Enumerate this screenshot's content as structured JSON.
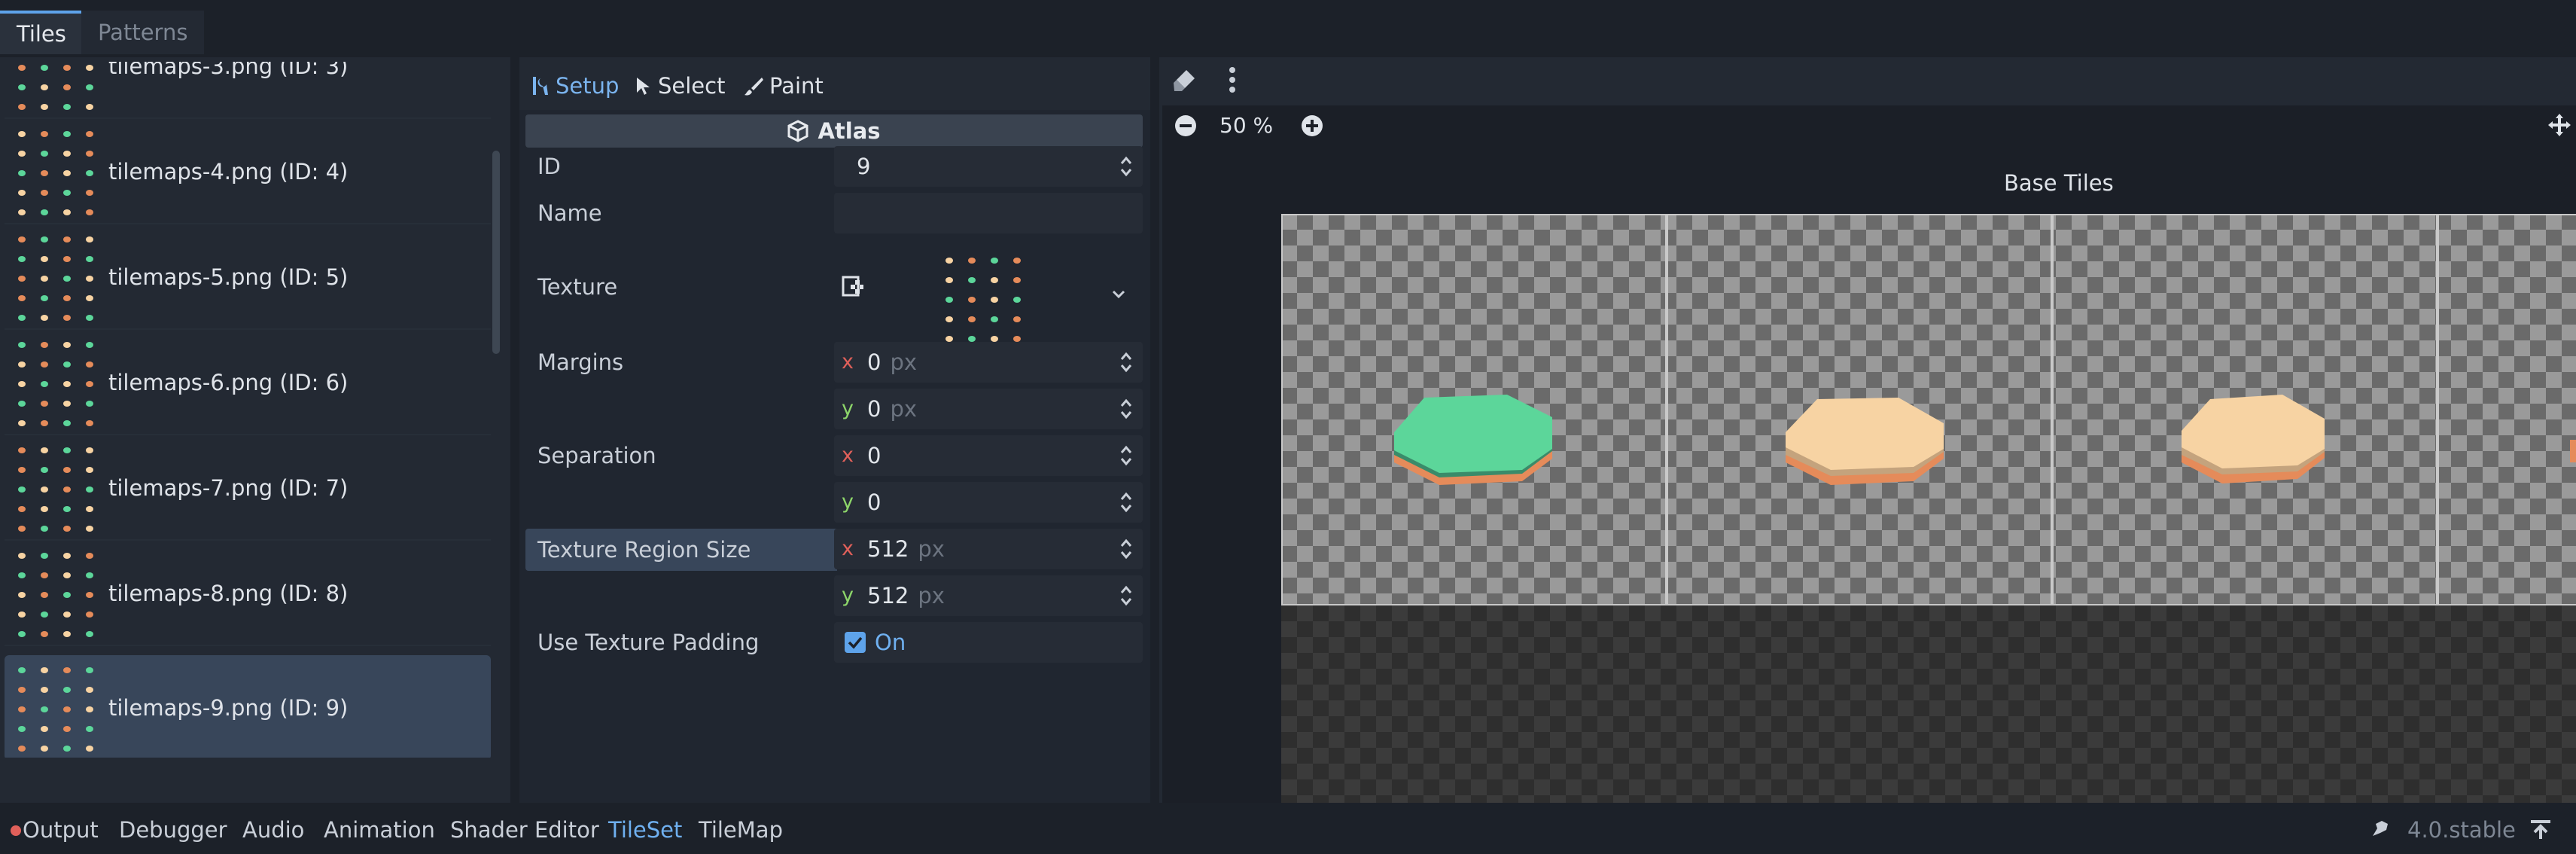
{
  "top_tabs": [
    {
      "label": "Tiles",
      "active": true
    },
    {
      "label": "Patterns",
      "active": false
    }
  ],
  "sources": [
    {
      "label": "tilemaps-3.png (ID: 3)",
      "selected": false
    },
    {
      "label": "tilemaps-4.png (ID: 4)",
      "selected": false
    },
    {
      "label": "tilemaps-5.png (ID: 5)",
      "selected": false
    },
    {
      "label": "tilemaps-6.png (ID: 6)",
      "selected": false
    },
    {
      "label": "tilemaps-7.png (ID: 7)",
      "selected": false
    },
    {
      "label": "tilemaps-8.png (ID: 8)",
      "selected": false
    },
    {
      "label": "tilemaps-9.png (ID: 9)",
      "selected": true
    }
  ],
  "left_toolbar": [
    "trash-icon",
    "plus-icon",
    "kebab-menu-icon",
    "sort-icon"
  ],
  "mode_tabs": [
    {
      "label": "Setup",
      "icon": "tools-icon",
      "active": true
    },
    {
      "label": "Select",
      "icon": "cursor-icon",
      "active": false
    },
    {
      "label": "Paint",
      "icon": "brush-icon",
      "active": false
    }
  ],
  "inspector": {
    "section_title": "Atlas",
    "id_label": "ID",
    "id_value": "9",
    "name_label": "Name",
    "name_value": "",
    "texture_label": "Texture",
    "margins_label": "Margins",
    "margins": {
      "x": "0",
      "y": "0",
      "unit": "px"
    },
    "separation_label": "Separation",
    "separation": {
      "x": "0",
      "y": "0"
    },
    "region_label": "Texture Region Size",
    "region": {
      "x": "512",
      "y": "512",
      "unit": "px"
    },
    "padding_label": "Use Texture Padding",
    "padding_value": "On",
    "padding_checked": true
  },
  "viewport": {
    "zoom": "50 %",
    "atlas_title": "Base Tiles",
    "tiles": [
      {
        "color": "#5cd69a"
      },
      {
        "color": "#f7d3a3"
      },
      {
        "color": "#f7d3a3"
      }
    ]
  },
  "bottom_tabs": [
    {
      "label": "Output",
      "active": false
    },
    {
      "label": "Debugger",
      "active": false
    },
    {
      "label": "Audio",
      "active": false
    },
    {
      "label": "Animation",
      "active": false
    },
    {
      "label": "Shader Editor",
      "active": false
    },
    {
      "label": "TileSet",
      "active": true
    },
    {
      "label": "TileMap",
      "active": false
    }
  ],
  "version": "4.0.stable",
  "colors": {
    "accent": "#5ea3ea",
    "error_dot": "#e0605a",
    "tile_green": "#5cd69a",
    "tile_peach": "#f7d3a3",
    "tile_orange": "#e58b5a"
  }
}
